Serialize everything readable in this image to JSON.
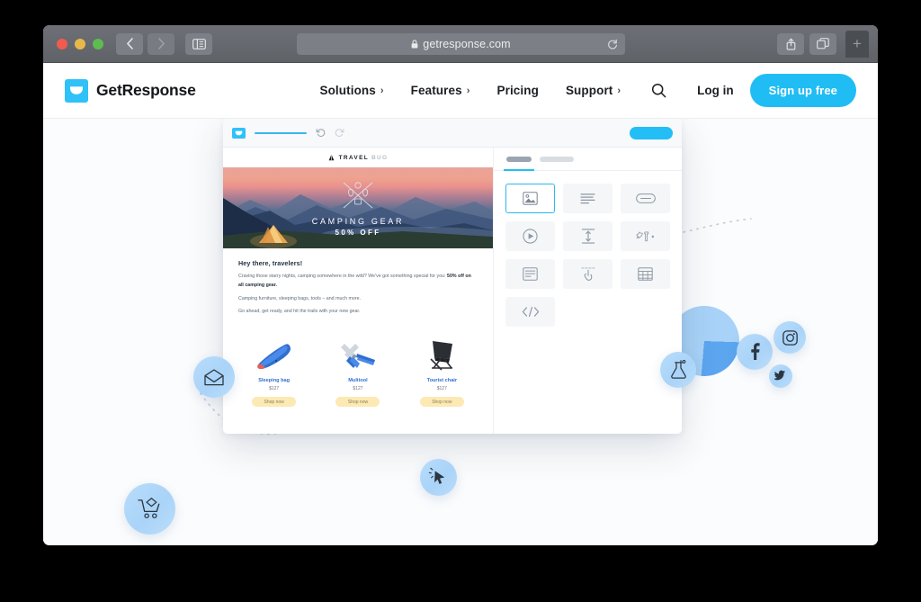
{
  "browser": {
    "url": "getresponse.com",
    "lock_icon": "lock-icon",
    "reload_icon": "reload-icon",
    "back_icon": "back-chevron-icon",
    "forward_icon": "forward-chevron-icon",
    "sidebar_icon": "sidebar-toggle-icon",
    "share_icon": "share-icon",
    "tabs_icon": "show-tabs-icon",
    "new_tab_label": "+"
  },
  "site": {
    "logo_text": "GetResponse",
    "nav": [
      {
        "label": "Solutions",
        "caret": "›"
      },
      {
        "label": "Features",
        "caret": "›"
      },
      {
        "label": "Pricing",
        "caret": ""
      },
      {
        "label": "Support",
        "caret": "›"
      }
    ],
    "search_icon": "search-icon",
    "login_label": "Log in",
    "cta_label": "Sign up free"
  },
  "editor": {
    "toolbar": {
      "undo_icon": "undo-icon",
      "redo_icon": "redo-icon",
      "save_pill": "",
      "logo_icon": "envelope-icon"
    },
    "email": {
      "brand_primary": "TRAVEL",
      "brand_secondary": "BUG",
      "brand_icon": "tent-icon",
      "banner_title": "CAMPING GEAR",
      "banner_subtitle": "50% OFF",
      "heading": "Hey there, travelers!",
      "paragraphs": [
        "Craving those starry nights, camping somewhere in the wild? We've got something special for you: ",
        "Camping furniture, sleeping bags, tools – and much more.",
        "Go ahead, get ready, and hit the trails with your new gear."
      ],
      "paragraph_bold": "50% off on all camping gear.",
      "products": [
        {
          "name": "Sleeping bag",
          "price": "$127",
          "button": "Shop now",
          "icon": "sleeping-bag-icon"
        },
        {
          "name": "Mulitool",
          "price": "$127",
          "button": "Shop now",
          "icon": "multitool-icon"
        },
        {
          "name": "Tourist chair",
          "price": "$127",
          "button": "Shop now",
          "icon": "camp-chair-icon"
        }
      ]
    },
    "panel": {
      "tabs": [
        "blocks-tab",
        "settings-tab"
      ],
      "tools": [
        {
          "name": "image-block",
          "icon": "image-icon",
          "selected": true
        },
        {
          "name": "text-block",
          "icon": "text-lines-icon",
          "selected": false
        },
        {
          "name": "button-block",
          "icon": "button-pill-icon",
          "selected": false
        },
        {
          "name": "video-block",
          "icon": "play-circle-icon",
          "selected": false
        },
        {
          "name": "spacer-block",
          "icon": "spacer-icon",
          "selected": false
        },
        {
          "name": "social-block",
          "icon": "social-icons-icon",
          "selected": false
        },
        {
          "name": "article-block",
          "icon": "article-card-icon",
          "selected": false
        },
        {
          "name": "drag-block",
          "icon": "drag-hand-icon",
          "selected": false
        },
        {
          "name": "table-block",
          "icon": "table-grid-icon",
          "selected": false
        },
        {
          "name": "html-block",
          "icon": "code-icon",
          "selected": false
        }
      ]
    }
  },
  "badges": [
    {
      "name": "cart-badge",
      "icon": "shopping-cart-icon"
    },
    {
      "name": "email-badge",
      "icon": "open-envelope-icon"
    },
    {
      "name": "click-badge",
      "icon": "click-cursor-icon"
    },
    {
      "name": "facebook-badge",
      "icon": "facebook-icon"
    },
    {
      "name": "instagram-badge",
      "icon": "instagram-icon"
    },
    {
      "name": "twitter-badge",
      "icon": "twitter-icon"
    },
    {
      "name": "lab-badge",
      "icon": "flask-icon"
    }
  ],
  "colors": {
    "brand_cyan": "#20bdf5",
    "badge_blue": "#aed6f9",
    "pie_light": "#a8d2f7",
    "pie_dark": "#5ca6ef",
    "link_blue": "#2f6fd0",
    "shop_button": "#fce9b4"
  }
}
